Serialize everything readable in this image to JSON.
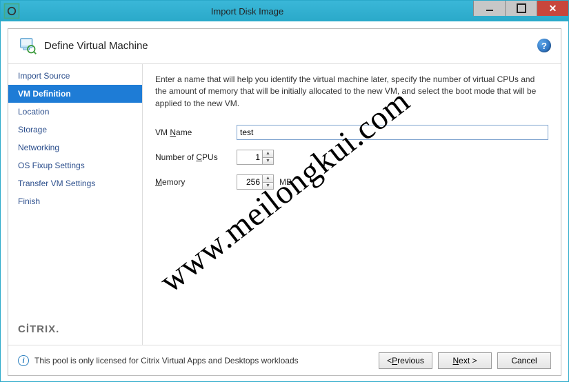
{
  "window": {
    "title": "Import Disk Image"
  },
  "header": {
    "title": "Define Virtual Machine"
  },
  "sidebar": {
    "items": [
      {
        "label": "Import Source"
      },
      {
        "label": "VM Definition"
      },
      {
        "label": "Location"
      },
      {
        "label": "Storage"
      },
      {
        "label": "Networking"
      },
      {
        "label": "OS Fixup Settings"
      },
      {
        "label": "Transfer VM Settings"
      },
      {
        "label": "Finish"
      }
    ],
    "brand": "CİTRIX"
  },
  "main": {
    "intro": "Enter a name that will help you identify the virtual machine later, specify the number of virtual CPUs and the amount of memory that will be initially allocated to the new VM, and select the boot mode that will be applied to the new VM.",
    "fields": {
      "vmname": {
        "label_prefix": "VM ",
        "label_ul": "N",
        "label_suffix": "ame",
        "value": "test"
      },
      "cpus": {
        "label_prefix": "Number of ",
        "label_ul": "C",
        "label_suffix": "PUs",
        "value": "1"
      },
      "memory": {
        "label_ul": "M",
        "label_suffix": "emory",
        "value": "256",
        "unit": "MB"
      }
    }
  },
  "footer": {
    "message": "This pool is only licensed for Citrix Virtual Apps and Desktops workloads",
    "buttons": {
      "prev": {
        "pre": "< ",
        "ul": "P",
        "post": "revious"
      },
      "next": {
        "ul": "N",
        "post": "ext >"
      },
      "cancel": {
        "label": "Cancel"
      }
    }
  },
  "watermark": "www.meilongkui.com"
}
